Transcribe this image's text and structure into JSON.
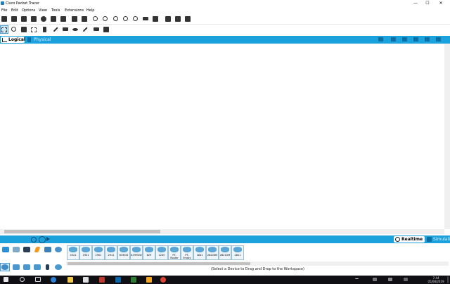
{
  "window": {
    "title": "Cisco Packet Tracer",
    "controls": {
      "minimize": "—",
      "maximize": "☐",
      "close": "✕"
    }
  },
  "menu": {
    "items": [
      "File",
      "Edit",
      "Options",
      "View",
      "Tools",
      "Extensions",
      "Help"
    ]
  },
  "workspace": {
    "logical_tab": "Logical",
    "physical_tab": "Physical"
  },
  "mode": {
    "realtime_label": "Realtime",
    "simulation_label": "Simulation"
  },
  "device_panel": {
    "devices": [
      "4321",
      "1941",
      "2901",
      "2911",
      "819IOX",
      "819HGW",
      "829",
      "1240",
      "PT-Router",
      "PT-Empty",
      "1841",
      "2620XM",
      "2621XM",
      "2811"
    ],
    "hint": "(Select a Device to Drag and Drop to the Workspace)"
  },
  "taskbar": {
    "time": "7:44",
    "date": "05/08/2019"
  },
  "colors": {
    "accent": "#1ba1dc",
    "taskbar": "#0f0f14"
  }
}
